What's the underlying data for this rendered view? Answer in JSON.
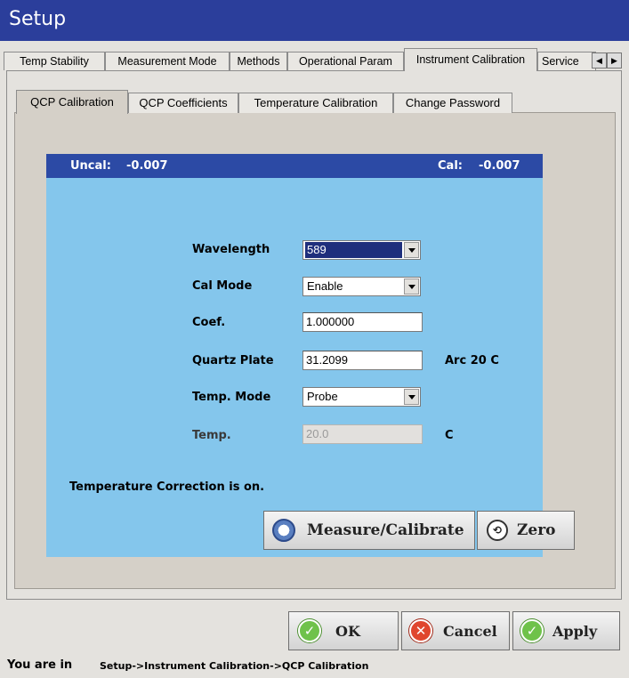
{
  "window": {
    "title": "Setup"
  },
  "outer_tabs": [
    {
      "label": "Temp Stability",
      "active": false
    },
    {
      "label": "Measurement Mode",
      "active": false
    },
    {
      "label": "Methods",
      "active": false
    },
    {
      "label": "Operational Param",
      "active": false
    },
    {
      "label": "Instrument Calibration",
      "active": true
    },
    {
      "label": "Service",
      "active": false
    }
  ],
  "inner_tabs": [
    {
      "label": "QCP Calibration",
      "active": true
    },
    {
      "label": "QCP Coefficients",
      "active": false
    },
    {
      "label": "Temperature Calibration",
      "active": false
    },
    {
      "label": "Change Password",
      "active": false
    }
  ],
  "header": {
    "uncal_label": "Uncal:",
    "uncal_value": "-0.007",
    "cal_label": "Cal:",
    "cal_value": "-0.007"
  },
  "form": {
    "wavelength": {
      "label": "Wavelength",
      "value": "589"
    },
    "cal_mode": {
      "label": "Cal Mode",
      "value": "Enable"
    },
    "coef": {
      "label": "Coef.",
      "value": "1.000000"
    },
    "quartz_plate": {
      "label": "Quartz Plate",
      "value": "31.2099",
      "unit": "Arc 20 C"
    },
    "temp_mode": {
      "label": "Temp. Mode",
      "value": "Probe"
    },
    "temp": {
      "label": "Temp.",
      "value": "20.0",
      "unit": "C"
    }
  },
  "status_message": "Temperature Correction is on.",
  "actions": {
    "measure_label": "Measure/Calibrate",
    "zero_label": "Zero"
  },
  "footer_buttons": {
    "ok": "OK",
    "cancel": "Cancel",
    "apply": "Apply"
  },
  "statusbar": {
    "prefix": "You are in",
    "path": "Setup->Instrument Calibration->QCP Calibration"
  },
  "icons": {
    "tab_scroll_left": "triangle-left-icon",
    "tab_scroll_right": "triangle-right-icon",
    "measure": "measure-dial-icon",
    "zero": "zero-reset-icon",
    "ok": "check-icon",
    "cancel": "x-icon",
    "apply": "check-icon"
  },
  "colors": {
    "title_bar": "#2b3e9b",
    "panel_header": "#2c4aa5",
    "panel_body": "#84c6ec",
    "ok_green": "#6fc24a",
    "cancel_red": "#e0462e"
  }
}
